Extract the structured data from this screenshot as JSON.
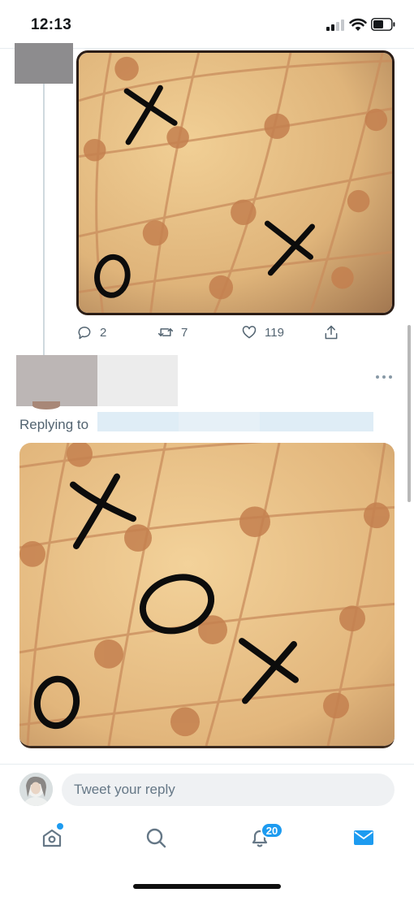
{
  "status_bar": {
    "time": "12:13",
    "signal_bars_active": 2,
    "signal_bars_total": 4
  },
  "tweet_1": {
    "actions": {
      "reply_count": "2",
      "retweet_count": "7",
      "like_count": "119"
    }
  },
  "tweet_2": {
    "replying_to_label": "Replying to"
  },
  "reply_bar": {
    "placeholder": "Tweet your reply"
  },
  "tab_bar": {
    "notifications_badge": "20",
    "active_tab": "messages",
    "accent_color": "#1d9bf0"
  },
  "icons": [
    "reply-icon",
    "retweet-icon",
    "like-icon",
    "share-icon",
    "more-icon",
    "home-icon",
    "search-icon",
    "notifications-icon",
    "messages-icon"
  ]
}
